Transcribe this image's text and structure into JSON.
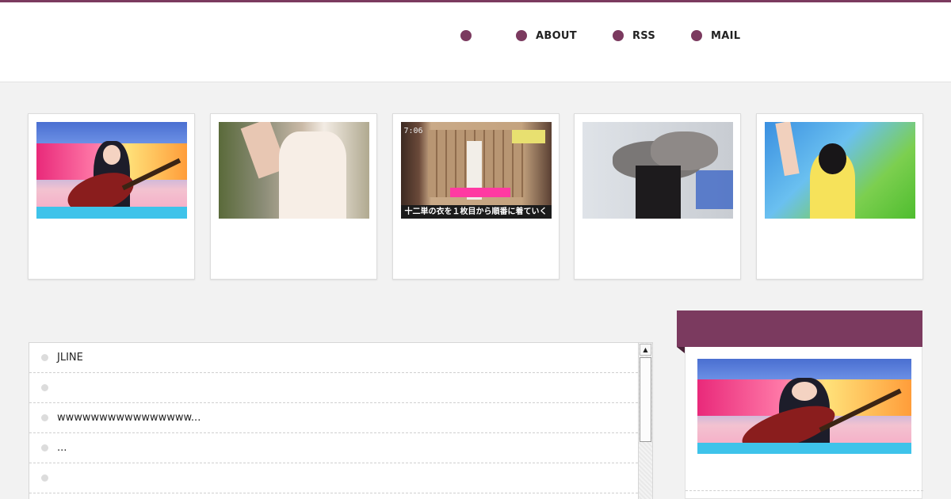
{
  "nav": {
    "items": [
      {
        "label": ""
      },
      {
        "label": "ABOUT"
      },
      {
        "label": "RSS"
      },
      {
        "label": "MAIL"
      }
    ]
  },
  "thumbnails": [
    {
      "scene": "girl-with-guitar-show-set"
    },
    {
      "scene": "woman-white-blouse-outdoors"
    },
    {
      "scene": "room-with-caption",
      "time": "7:06",
      "caption": "十二単の衣を１枚目から順番に着ていく"
    },
    {
      "scene": "fur-costume-stage"
    },
    {
      "scene": "singer-green-stage"
    }
  ],
  "list": {
    "rows": [
      {
        "text": "JLINE"
      },
      {
        "text": ""
      },
      {
        "text": "wwwwwwwwwwwwwwww..."
      },
      {
        "text": "..."
      },
      {
        "text": ""
      }
    ]
  },
  "sidebar": {
    "header_color": "#7b3a5f",
    "thumb_scene": "girl-with-guitar-show-set"
  },
  "colors": {
    "accent": "#7b3a5f",
    "background": "#f2f2f2"
  }
}
